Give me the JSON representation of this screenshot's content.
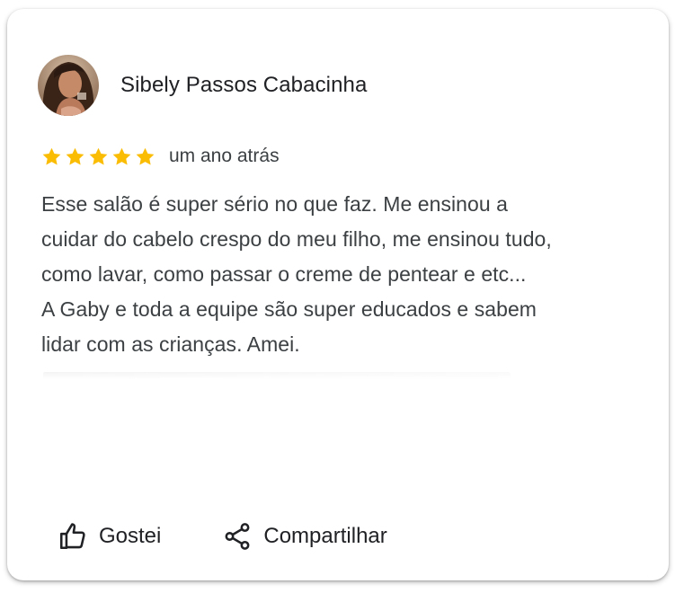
{
  "review": {
    "reviewer_name": "Sibely Passos Cabacinha",
    "rating": 5,
    "rating_max": 5,
    "date": "um ano atrás",
    "text_lines": [
      "Esse salão é super sério no que faz. Me ensinou a",
      "cuidar do cabelo crespo do meu filho, me ensinou tudo,",
      "como lavar, como passar o creme de pentear e etc...",
      "A Gaby e toda a equipe são super educados e sabem",
      "lidar com as crianças. Amei."
    ]
  },
  "actions": {
    "like_label": "Gostei",
    "share_label": "Compartilhar"
  },
  "colors": {
    "star": "#fbbc04",
    "text": "#3c4043",
    "name": "#202124"
  },
  "icons": {
    "like": "thumbs-up-icon",
    "share": "share-icon"
  }
}
